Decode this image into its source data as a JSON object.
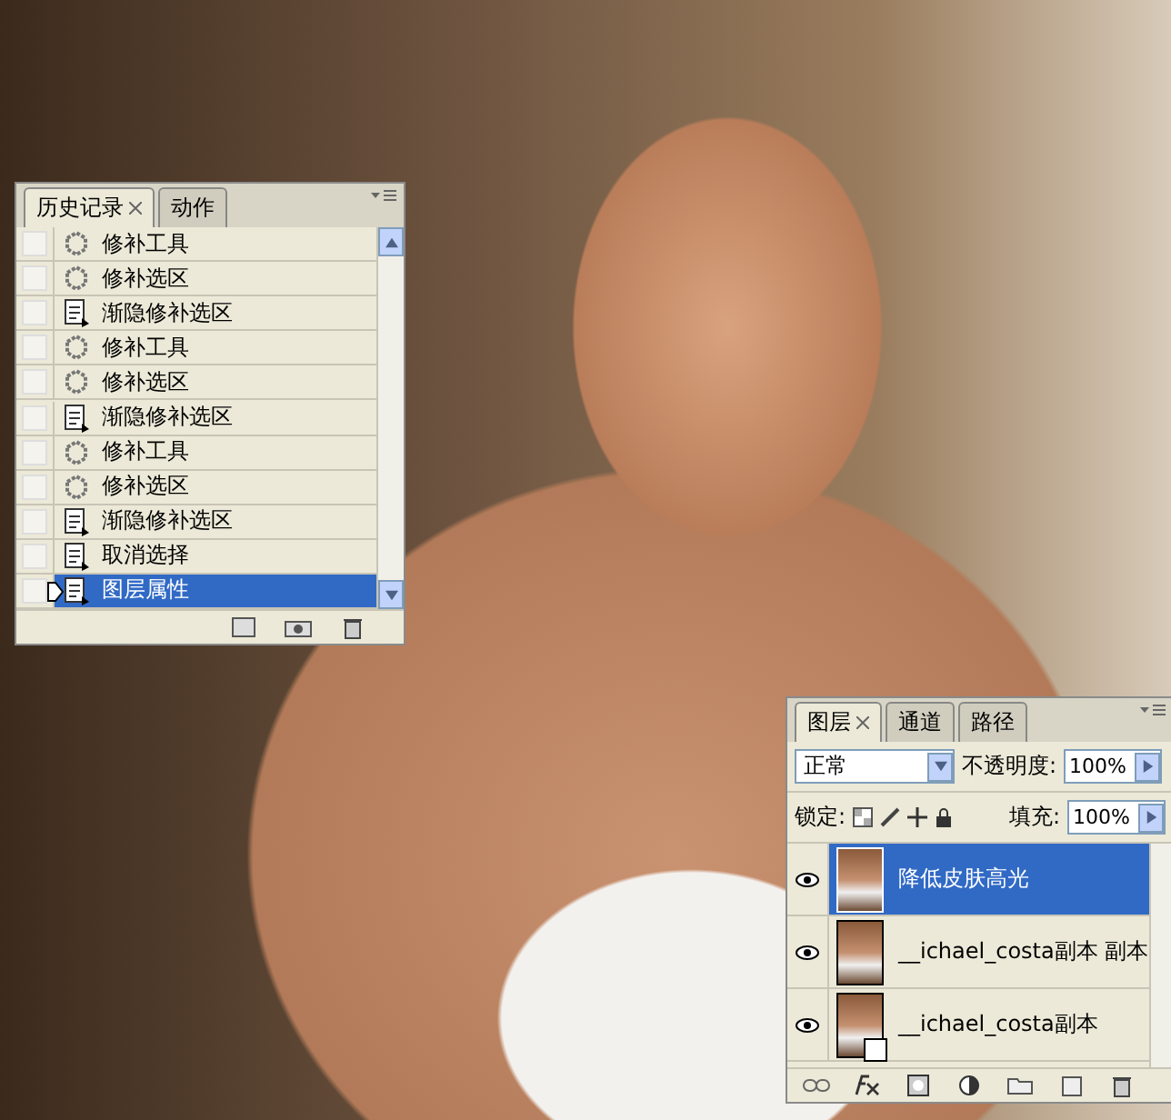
{
  "history_panel": {
    "tabs": [
      {
        "label": "历史记录",
        "selected": true,
        "closable": true
      },
      {
        "label": "动作",
        "selected": false,
        "closable": false
      }
    ],
    "items": [
      {
        "label": "修补工具",
        "kind": "patch",
        "selected": false,
        "snapshot": false
      },
      {
        "label": "修补选区",
        "kind": "patch",
        "selected": false,
        "snapshot": false
      },
      {
        "label": "渐隐修补选区",
        "kind": "doc",
        "selected": false,
        "snapshot": false
      },
      {
        "label": "修补工具",
        "kind": "patch",
        "selected": false,
        "snapshot": false
      },
      {
        "label": "修补选区",
        "kind": "patch",
        "selected": false,
        "snapshot": false
      },
      {
        "label": "渐隐修补选区",
        "kind": "doc",
        "selected": false,
        "snapshot": false
      },
      {
        "label": "修补工具",
        "kind": "patch",
        "selected": false,
        "snapshot": false
      },
      {
        "label": "修补选区",
        "kind": "patch",
        "selected": false,
        "snapshot": false
      },
      {
        "label": "渐隐修补选区",
        "kind": "doc",
        "selected": false,
        "snapshot": false
      },
      {
        "label": "取消选择",
        "kind": "doc",
        "selected": false,
        "snapshot": false
      },
      {
        "label": "图层属性",
        "kind": "doc",
        "selected": true,
        "snapshot": false
      }
    ]
  },
  "layers_panel": {
    "tabs": [
      {
        "label": "图层",
        "selected": true,
        "closable": true
      },
      {
        "label": "通道",
        "selected": false,
        "closable": false
      },
      {
        "label": "路径",
        "selected": false,
        "closable": false
      }
    ],
    "blend_mode": "正常",
    "opacity_label": "不透明度:",
    "opacity": "100%",
    "lock_label": "锁定:",
    "fill_label": "填充:",
    "fill": "100%",
    "layers": [
      {
        "name": "降低皮肤高光",
        "visible": true,
        "selected": true,
        "smart_object": false
      },
      {
        "name": "__ichael_costa副本 副本",
        "visible": true,
        "selected": false,
        "smart_object": false
      },
      {
        "name": "__ichael_costa副本",
        "visible": true,
        "selected": false,
        "smart_object": true
      }
    ]
  }
}
